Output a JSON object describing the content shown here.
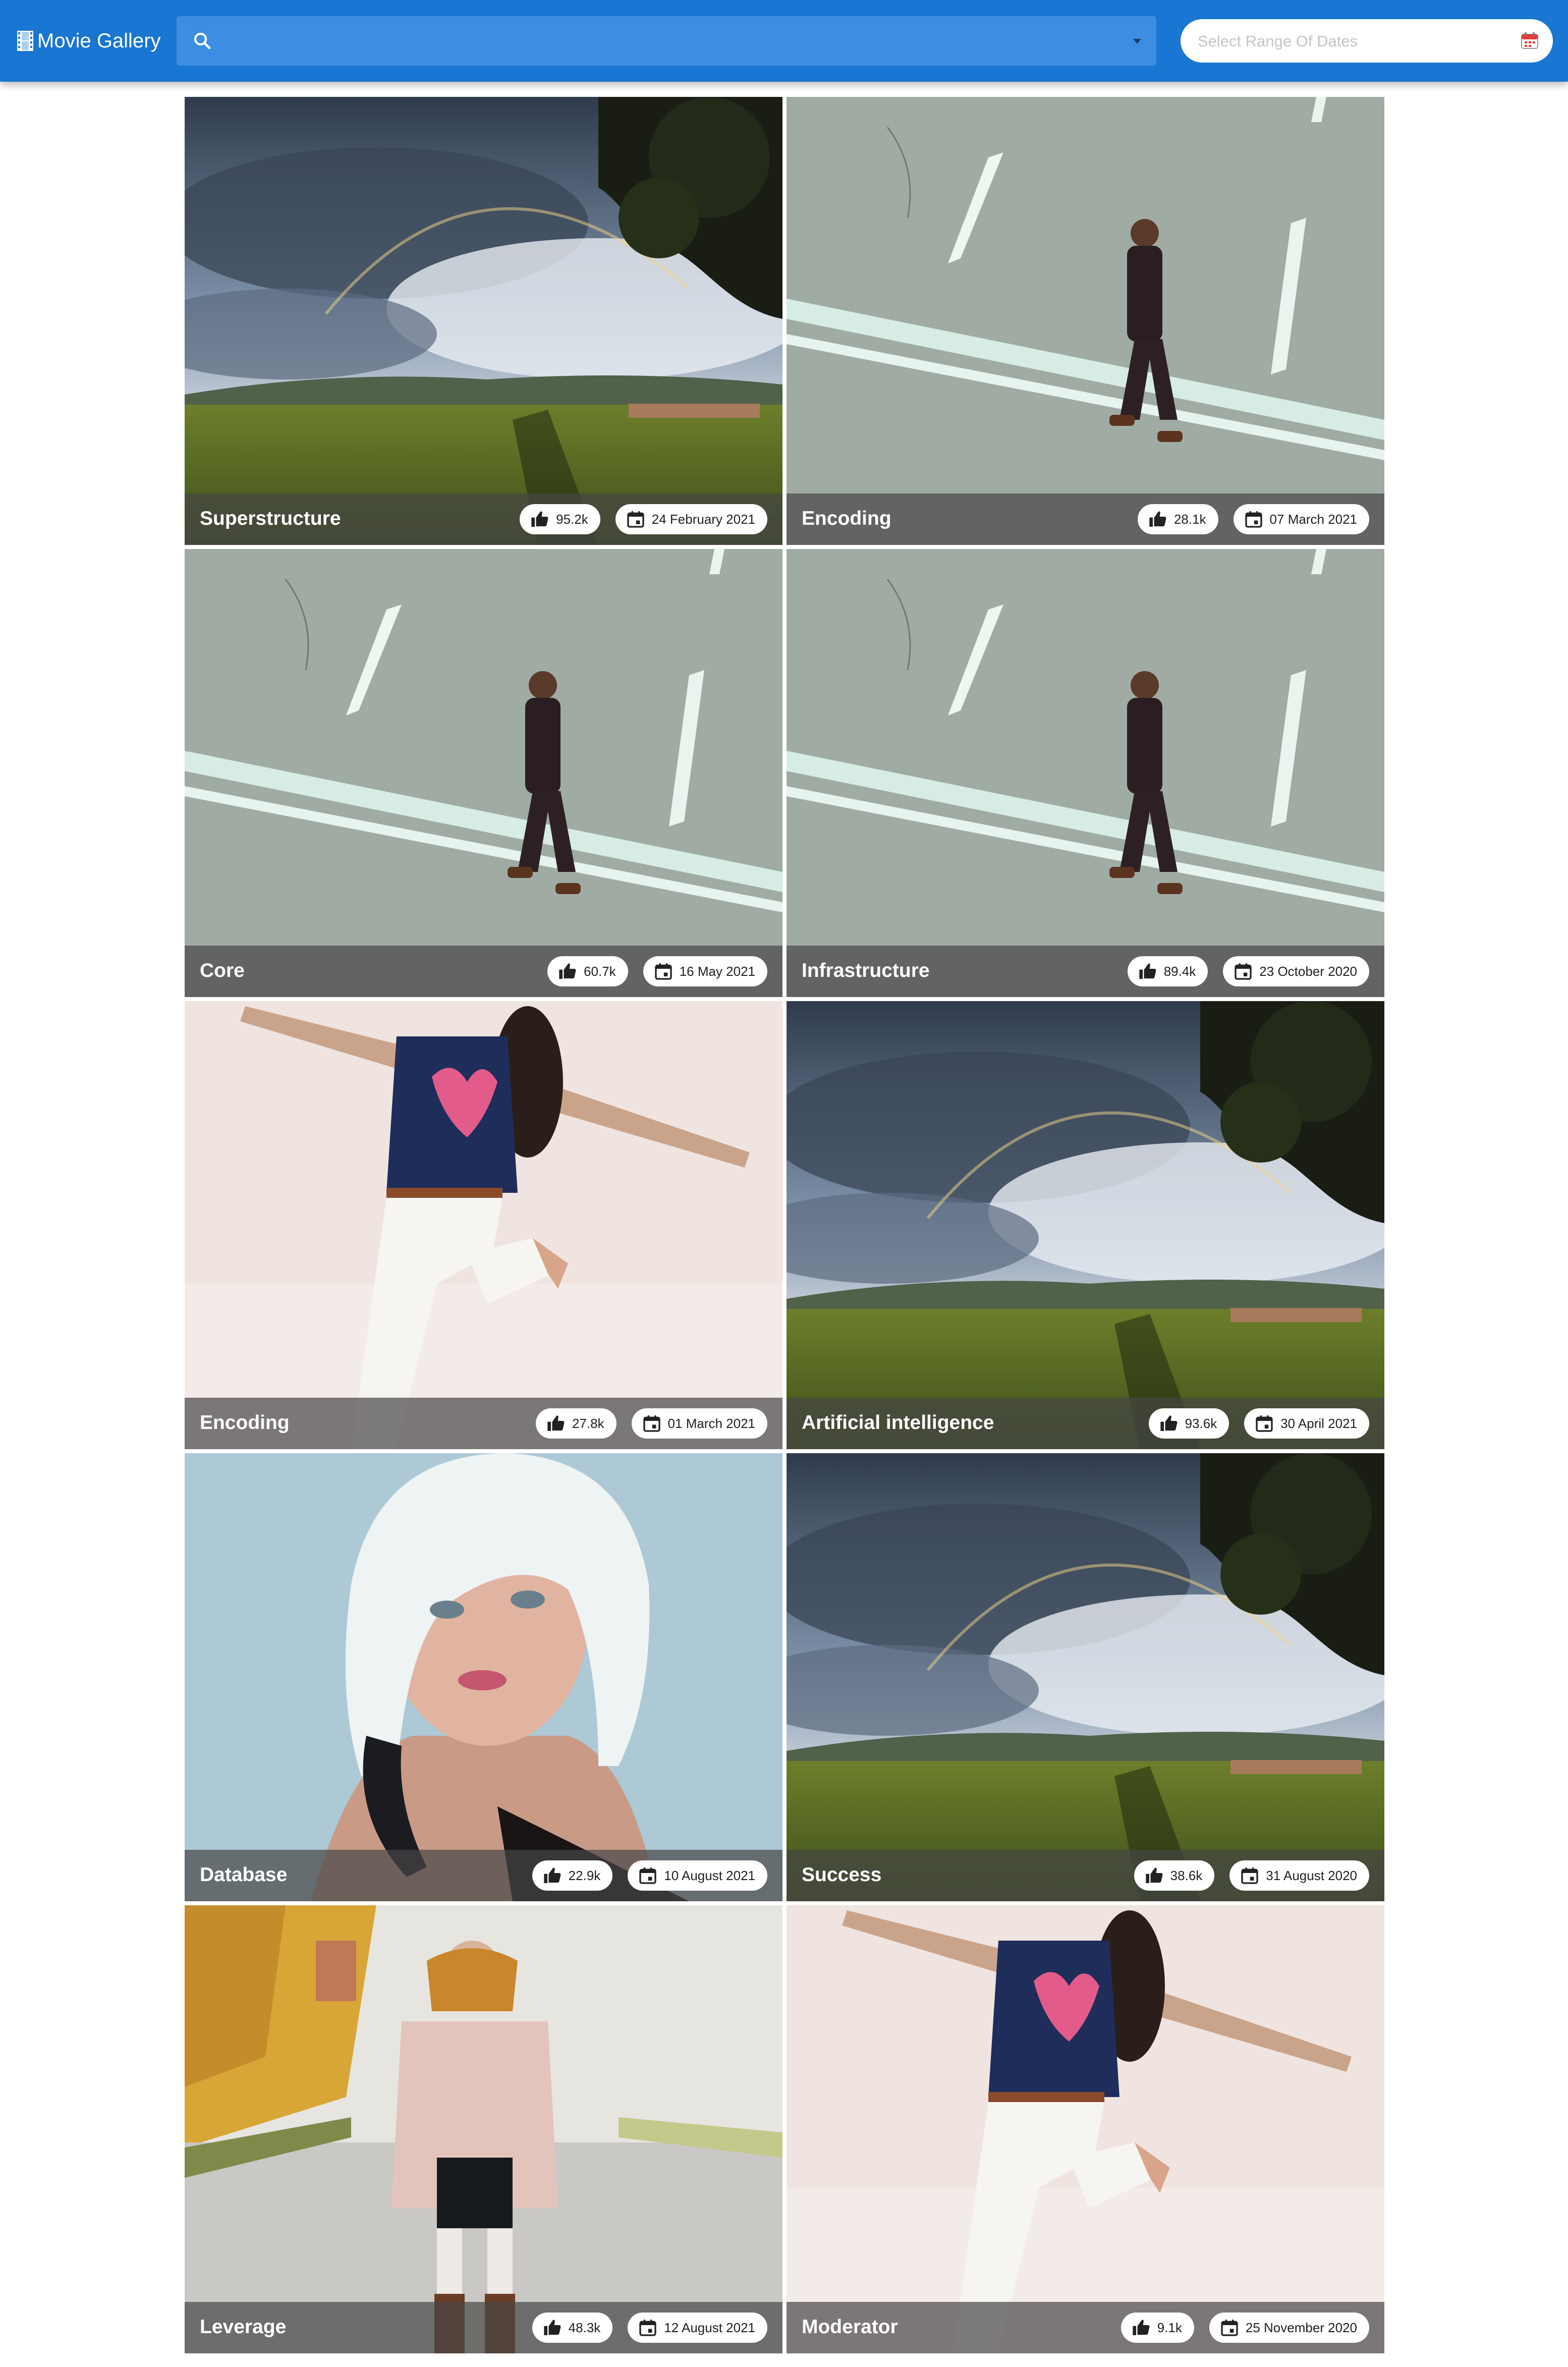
{
  "app": {
    "title": "Movie Gallery",
    "brand_icon": "film-icon",
    "accent_color": "#1976d2"
  },
  "search": {
    "value": "",
    "icon": "search-icon",
    "dropdown_icon": "chevron-down-icon"
  },
  "date_range": {
    "placeholder": "Select Range Of Dates",
    "value": "",
    "icon": "calendar-icon"
  },
  "cards": [
    {
      "title": "Superstructure",
      "likes": "95.2k",
      "date": "24 February 2021",
      "image": "rainbow-landscape"
    },
    {
      "title": "Encoding",
      "likes": "28.1k",
      "date": "07 March 2021",
      "image": "man-walking-road"
    },
    {
      "title": "Core",
      "likes": "60.7k",
      "date": "16 May 2021",
      "image": "man-walking-road"
    },
    {
      "title": "Infrastructure",
      "likes": "89.4k",
      "date": "23 October 2020",
      "image": "man-walking-road"
    },
    {
      "title": "Encoding",
      "likes": "27.8k",
      "date": "01 March 2021",
      "image": "jumping-woman"
    },
    {
      "title": "Artificial intelligence",
      "likes": "93.6k",
      "date": "30 April 2021",
      "image": "rainbow-landscape"
    },
    {
      "title": "Database",
      "likes": "22.9k",
      "date": "10 August 2021",
      "image": "blonde-portrait"
    },
    {
      "title": "Success",
      "likes": "38.6k",
      "date": "31 August 2020",
      "image": "rainbow-landscape"
    },
    {
      "title": "Leverage",
      "likes": "48.3k",
      "date": "12 August 2021",
      "image": "autumn-street-woman"
    },
    {
      "title": "Moderator",
      "likes": "9.1k",
      "date": "25 November 2020",
      "image": "jumping-woman"
    }
  ]
}
